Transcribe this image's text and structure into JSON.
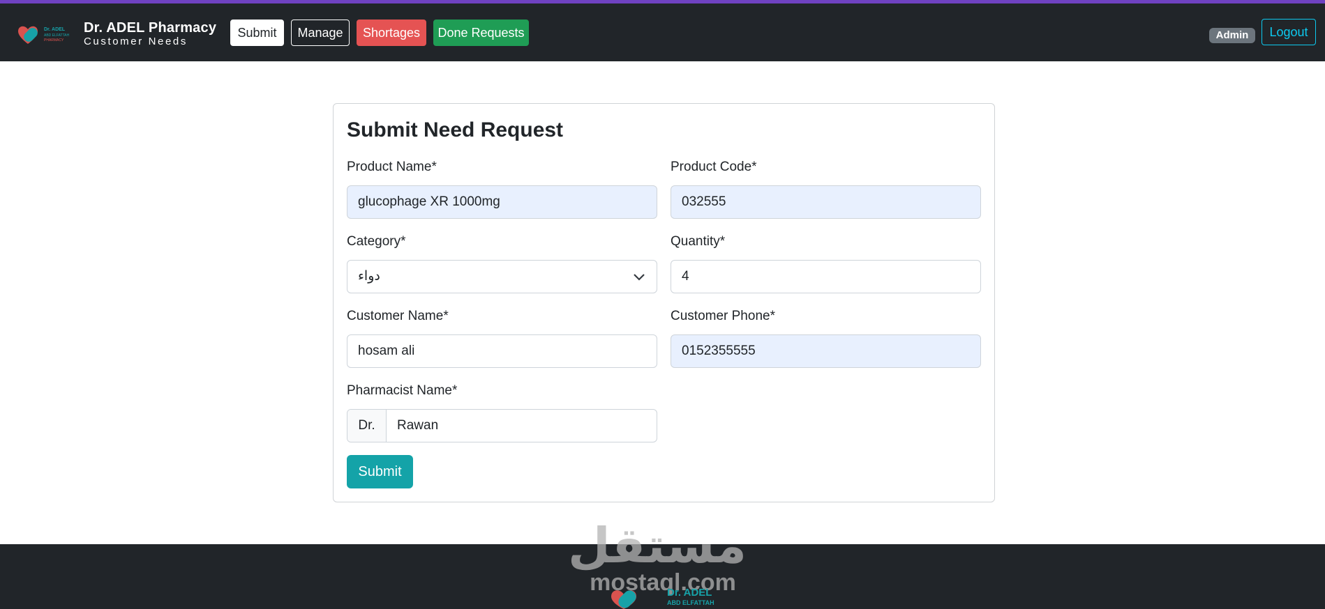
{
  "brand": {
    "title": "Dr. ADEL Pharmacy",
    "subtitle": "Customer Needs",
    "logo_text": [
      "Dr. ADEL",
      "ABD ELFATTAH",
      "PHARMACY"
    ]
  },
  "nav": {
    "submit_label": "Submit",
    "manage_label": "Manage",
    "shortages_label": "Shortages",
    "done_label": "Done Requests",
    "admin_badge": "Admin",
    "logout_label": "Logout"
  },
  "form": {
    "title": "Submit Need Request",
    "product_name": {
      "label": "Product Name*",
      "value": "glucophage XR 1000mg"
    },
    "product_code": {
      "label": "Product Code*",
      "value": "032555"
    },
    "category": {
      "label": "Category*",
      "value": "دواء"
    },
    "quantity": {
      "label": "Quantity*",
      "value": "4"
    },
    "customer_name": {
      "label": "Customer Name*",
      "value": "hosam ali"
    },
    "customer_phone": {
      "label": "Customer Phone*",
      "value": "0152355555"
    },
    "pharmacist_name": {
      "label": "Pharmacist Name*",
      "prefix": "Dr.",
      "value": "Rawan"
    },
    "submit_label": "Submit"
  },
  "footer": {
    "watermark_arabic": "مستقل",
    "watermark_latin": "mostaql.com",
    "logo_text": [
      "Dr. ADEL",
      "ABD ELFATTAH"
    ]
  },
  "colors": {
    "navbar": "#212529",
    "accent_top": "#6f42c1",
    "shortages": "#e55353",
    "done": "#1f9d55",
    "submit": "#14a3a8",
    "logout": "#0dcaf0",
    "autofill": "#e8f0fe"
  },
  "icons": {
    "logo": "pharmacy-heart-logo",
    "select": "chevron-down-icon"
  }
}
